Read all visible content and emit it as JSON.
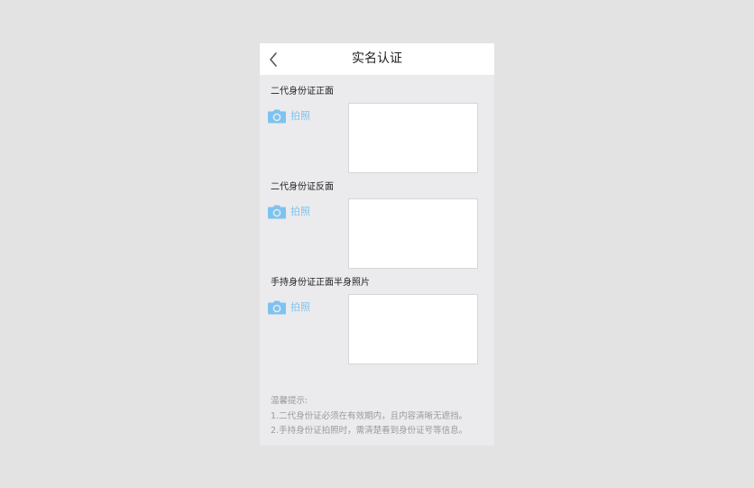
{
  "header": {
    "title": "实名认证"
  },
  "sections": [
    {
      "label": "二代身份证正面",
      "photo_label": "拍照"
    },
    {
      "label": "二代身份证反面",
      "photo_label": "拍照"
    },
    {
      "label": "手持身份证正面半身照片",
      "photo_label": "拍照"
    }
  ],
  "tips": {
    "title": "温馨提示:",
    "line1": "1.二代身份证必须在有效期内，且内容清晰无遮挡。",
    "line2": "2.手持身份证拍照时，需清楚看到身份证号等信息。"
  },
  "colors": {
    "accent": "#7ec3f0",
    "background": "#ebebed",
    "navbar": "#ffffff"
  },
  "icons": {
    "back": "chevron-left-icon",
    "camera": "camera-icon"
  }
}
